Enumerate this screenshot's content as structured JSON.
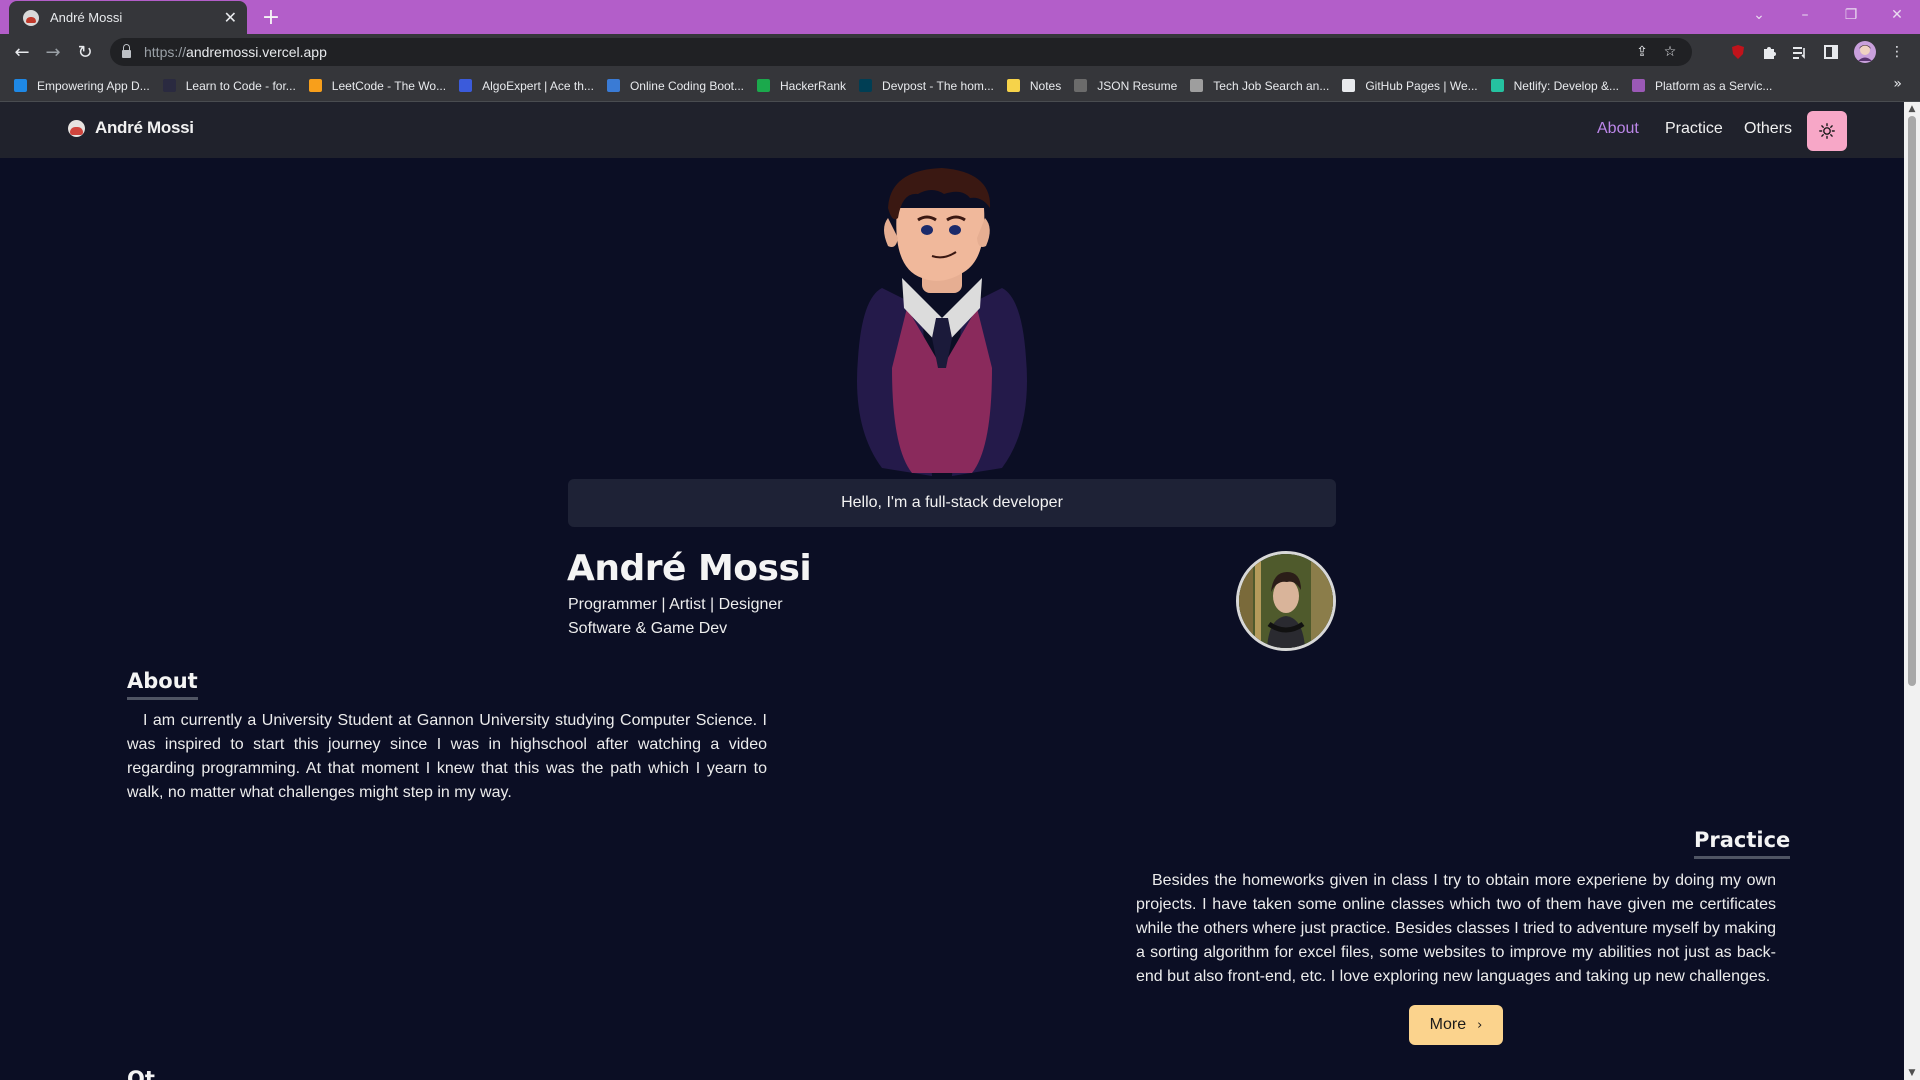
{
  "browser": {
    "tab_title": "André Mossi",
    "tab_close": "✕",
    "new_tab": "+",
    "url_scheme": "https://",
    "url_host": "andremossi.vercel.app",
    "bookmarks": [
      {
        "label": "Empowering App D...",
        "icon_color": "#1e88e5"
      },
      {
        "label": "Learn to Code - for...",
        "icon_color": "#2a2a40"
      },
      {
        "label": "LeetCode - The Wo...",
        "icon_color": "#f89f1b"
      },
      {
        "label": "AlgoExpert | Ace th...",
        "icon_color": "#3b5bdb"
      },
      {
        "label": "Online Coding Boot...",
        "icon_color": "#3a7bd5"
      },
      {
        "label": "HackerRank",
        "icon_color": "#1ba94c"
      },
      {
        "label": "Devpost - The hom...",
        "icon_color": "#003e54"
      },
      {
        "label": "Notes",
        "icon_color": "#f6d34a"
      },
      {
        "label": "JSON Resume",
        "icon_color": "#6b6b6b"
      },
      {
        "label": "Tech Job Search an...",
        "icon_color": "#9e9e9e"
      },
      {
        "label": "GitHub Pages | We...",
        "icon_color": "#e8eaed"
      },
      {
        "label": "Netlify: Develop &...",
        "icon_color": "#25c2a0"
      },
      {
        "label": "Platform as a Servic...",
        "icon_color": "#9b59b6"
      }
    ],
    "bookmarks_overflow": "»"
  },
  "site": {
    "brand": "André Mossi",
    "nav": [
      "About",
      "Practice",
      "Others"
    ],
    "accent_color": "#bb86e8",
    "theme_button_color": "#f7a7c7"
  },
  "hero": {
    "greeting": "Hello, I'm a full-stack developer",
    "name": "André Mossi",
    "roles": "Programmer | Artist | Designer",
    "focus": "Software & Game Dev"
  },
  "about": {
    "title": "About",
    "text": "I am currently a University Student at Gannon University studying Computer Science. I was inspired to start this journey since I was in highschool after watching a video regarding programming. At that moment I knew that this was the path which I yearn to walk, no matter what challenges might step in my way."
  },
  "practice": {
    "title": "Practice",
    "text": "Besides the homeworks given in class I try to obtain more experiene by doing my own projects. I have taken some online classes which two of them have given me certificates while the others where just practice. Besides classes I tried to adventure myself by making a sorting algorithm for excel files, some websites to improve my abilities not just as back-end but also front-end, etc. I love exploring new languages and taking up new challenges.",
    "button": "More",
    "button_color": "#fbd38d"
  },
  "next_section_partial": "Ot"
}
